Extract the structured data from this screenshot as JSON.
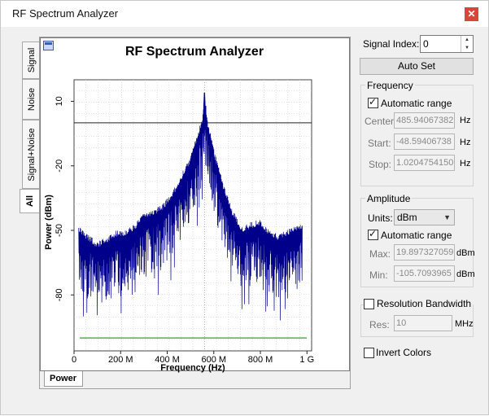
{
  "window": {
    "title": "RF Spectrum Analyzer"
  },
  "tabs": [
    {
      "label": "Signal"
    },
    {
      "label": "Noise"
    },
    {
      "label": "Signal+Noise"
    },
    {
      "label": "All"
    }
  ],
  "bottom_tab": {
    "label": "Power"
  },
  "controls": {
    "signal_index_label": "Signal Index:",
    "signal_index_value": "0",
    "auto_set_label": "Auto Set",
    "frequency": {
      "title": "Frequency",
      "automatic_range_label": "Automatic range",
      "automatic_range_checked": true,
      "center_label": "Center:",
      "center_value": "485.94067382",
      "center_unit": "Hz",
      "start_label": "Start:",
      "start_value": "-48.59406738",
      "start_unit": "Hz",
      "stop_label": "Stop:",
      "stop_value": "1.0204754150",
      "stop_unit": "Hz"
    },
    "amplitude": {
      "title": "Amplitude",
      "units_label": "Units:",
      "units_value": "dBm",
      "automatic_range_label": "Automatic range",
      "automatic_range_checked": true,
      "max_label": "Max:",
      "max_value": "19.897327059",
      "max_unit": "dBm",
      "min_label": "Min:",
      "min_value": "-105.7093965",
      "min_unit": "dBm"
    },
    "resolution_bandwidth": {
      "label": "Resolution Bandwidth",
      "checked": false,
      "res_label": "Res:",
      "res_value": "10",
      "res_unit": "MHz"
    },
    "invert_colors": {
      "label": "Invert Colors",
      "checked": false
    }
  },
  "colors": {
    "trace": "#00008b",
    "noise_floor": "#22aa22",
    "grid": "#c8c8c8",
    "close_button": "#d8463a"
  },
  "chart_data": {
    "type": "line",
    "title": "RF Spectrum Analyzer",
    "xlabel": "Frequency (Hz)",
    "ylabel": "Power (dBm)",
    "x_ticks": [
      {
        "value": 0,
        "label": "0"
      },
      {
        "value": 200000000,
        "label": "200 M"
      },
      {
        "value": 400000000,
        "label": "400 M"
      },
      {
        "value": 600000000,
        "label": "600 M"
      },
      {
        "value": 800000000,
        "label": "800 M"
      },
      {
        "value": 1000000000,
        "label": "1 G"
      }
    ],
    "y_ticks": [
      {
        "value": 10,
        "label": "10"
      },
      {
        "value": -20,
        "label": "-20"
      },
      {
        "value": -50,
        "label": "-50"
      },
      {
        "value": -80,
        "label": "-80"
      }
    ],
    "xlim": [
      0,
      1020000000
    ],
    "ylim": [
      -106,
      20
    ],
    "grid": true,
    "peak": {
      "x": 560000000,
      "y": 14
    },
    "reference_line_y": 0,
    "noise_floor_y": -100,
    "envelope": [
      {
        "x": 20000000,
        "y": -48
      },
      {
        "x": 60000000,
        "y": -52
      },
      {
        "x": 100000000,
        "y": -55
      },
      {
        "x": 140000000,
        "y": -53
      },
      {
        "x": 180000000,
        "y": -50
      },
      {
        "x": 220000000,
        "y": -50
      },
      {
        "x": 260000000,
        "y": -47
      },
      {
        "x": 300000000,
        "y": -42
      },
      {
        "x": 340000000,
        "y": -40
      },
      {
        "x": 380000000,
        "y": -38
      },
      {
        "x": 420000000,
        "y": -32
      },
      {
        "x": 460000000,
        "y": -24
      },
      {
        "x": 500000000,
        "y": -15
      },
      {
        "x": 530000000,
        "y": -5
      },
      {
        "x": 550000000,
        "y": 2
      },
      {
        "x": 560000000,
        "y": 14
      },
      {
        "x": 575000000,
        "y": 0
      },
      {
        "x": 600000000,
        "y": -12
      },
      {
        "x": 640000000,
        "y": -28
      },
      {
        "x": 680000000,
        "y": -40
      },
      {
        "x": 720000000,
        "y": -48
      },
      {
        "x": 760000000,
        "y": -46
      },
      {
        "x": 800000000,
        "y": -45
      },
      {
        "x": 840000000,
        "y": -50
      },
      {
        "x": 880000000,
        "y": -52
      },
      {
        "x": 920000000,
        "y": -49
      },
      {
        "x": 980000000,
        "y": -47
      }
    ]
  }
}
